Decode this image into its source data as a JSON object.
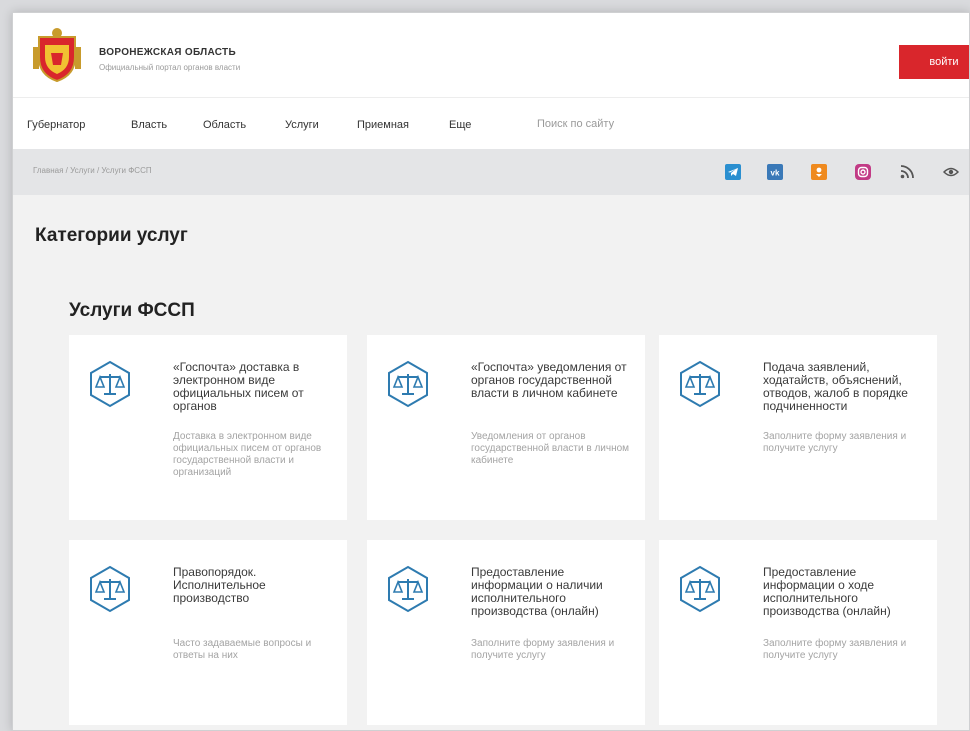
{
  "header": {
    "site_title": "ВОРОНЕЖСКАЯ ОБЛАСТЬ",
    "site_subtitle": "Официальный портал органов власти",
    "login_label": "войти"
  },
  "nav": {
    "items": [
      "Губернатор",
      "Власть",
      "Область",
      "Услуги",
      "Приемная",
      "Еще"
    ],
    "search_placeholder": "Поиск по сайту"
  },
  "breadcrumb": "Главная / Услуги / Услуги ФССП",
  "social_icons": [
    "telegram-icon",
    "vk-icon",
    "ok-icon",
    "instagram-icon",
    "rss-icon",
    "eye-icon"
  ],
  "colors": {
    "accent": "#d9262c",
    "icon": "#2e7bb0",
    "telegram": "#2a8fd0",
    "vk": "#3a79b8",
    "ok": "#ef8a1f",
    "instagram": "#c23b86"
  },
  "main": {
    "page_title": "Категории услуг",
    "section_title": "Услуги ФССП",
    "cards": [
      {
        "title": "«Госпочта» доставка в электронном виде официальных писем от органов",
        "desc": "Доставка в электронном виде официальных писем от органов государственной власти и организаций"
      },
      {
        "title": "«Госпочта» уведомления от органов государственной власти в личном кабинете",
        "desc": "Уведомления от органов государственной власти в личном кабинете"
      },
      {
        "title": "Подача заявлений, ходатайств, объяснений, отводов, жалоб в порядке подчиненности",
        "desc": "Заполните форму заявления и получите услугу"
      },
      {
        "title": "Правопорядок. Исполнительное производство",
        "desc": "Часто задаваемые вопросы и ответы на них"
      },
      {
        "title": "Предоставление информации о наличии исполнительного производства (онлайн)",
        "desc": "Заполните форму заявления и получите услугу"
      },
      {
        "title": "Предоставление информации о ходе исполнительного производства (онлайн)",
        "desc": "Заполните форму заявления и получите услугу"
      }
    ]
  }
}
